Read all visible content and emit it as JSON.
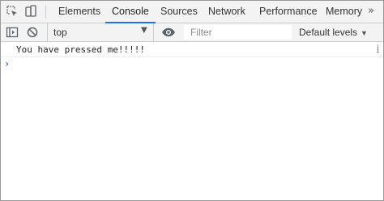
{
  "tabs": {
    "items": [
      "Elements",
      "Console",
      "Sources",
      "Network",
      "Performance",
      "Memory"
    ],
    "active": "Console",
    "more_glyph": "»"
  },
  "toolbar": {
    "context": "top",
    "filter_placeholder": "Filter",
    "levels_label": "Default levels"
  },
  "console": {
    "messages": [
      {
        "text": "You have pressed me!!!!!",
        "source_glyph": "i"
      }
    ],
    "prompt_glyph": "›"
  },
  "colors": {
    "accent": "#1a73e8",
    "toolbar_bg": "#f3f3f3",
    "border": "#cbcdd1"
  },
  "icons": [
    "inspect-element-icon",
    "device-toolbar-icon",
    "sidebar-toggle-icon",
    "clear-console-icon",
    "dropdown-arrow-icon",
    "eye-icon",
    "more-tabs-icon"
  ]
}
